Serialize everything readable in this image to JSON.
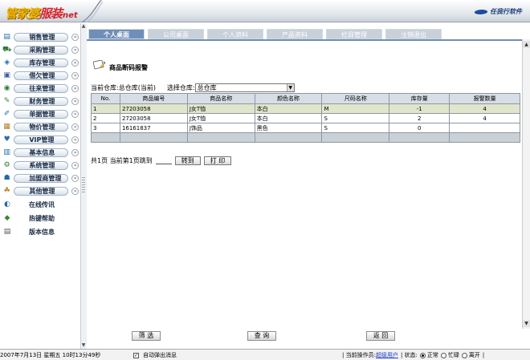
{
  "header": {
    "logo_part1": "管家婆",
    "logo_part2": "服装",
    "logo_part3": "net",
    "brand": "任我行软件"
  },
  "sidebar": {
    "items": [
      {
        "label": "销售管理",
        "icon": "sales-icon"
      },
      {
        "label": "采购管理",
        "icon": "purchase-icon"
      },
      {
        "label": "库存管理",
        "icon": "inventory-icon"
      },
      {
        "label": "借欠管理",
        "icon": "loan-icon"
      },
      {
        "label": "往来管理",
        "icon": "transaction-icon"
      },
      {
        "label": "财务管理",
        "icon": "finance-icon"
      },
      {
        "label": "单据管理",
        "icon": "voucher-icon"
      },
      {
        "label": "物价管理",
        "icon": "price-icon"
      },
      {
        "label": "VIP管理",
        "icon": "vip-icon"
      },
      {
        "label": "基本信息",
        "icon": "basic-info-icon"
      },
      {
        "label": "系统管理",
        "icon": "system-icon"
      },
      {
        "label": "加盟商管理",
        "icon": "franchise-icon"
      },
      {
        "label": "其他管理",
        "icon": "other-icon"
      },
      {
        "label": "在线传讯",
        "icon": "online-message-icon"
      },
      {
        "label": "热键帮助",
        "icon": "hotkey-help-icon"
      },
      {
        "label": "版本信息",
        "icon": "version-info-icon"
      }
    ]
  },
  "tabs": [
    {
      "label": "个人桌面",
      "active": true
    },
    {
      "label": "公司桌面",
      "active": false
    },
    {
      "label": "个人资料",
      "active": false
    },
    {
      "label": "产品资料",
      "active": false
    },
    {
      "label": "栏目管理",
      "active": false
    },
    {
      "label": "注销退出",
      "active": false
    }
  ],
  "main": {
    "page_title": "商品断码报警",
    "current_warehouse": "当前仓库:总仓库(当前)",
    "select_label": "选择仓库:",
    "select_value": "总仓库",
    "table": {
      "headers": [
        "No.",
        "商品编号",
        "商品名称",
        "颜色名称",
        "尺码名称",
        "库存量",
        "报警数量"
      ],
      "rows": [
        [
          "1",
          "27203058",
          "J女T恤",
          "本白",
          "M",
          "-1",
          "4"
        ],
        [
          "2",
          "27203058",
          "J女T恤",
          "本白",
          "S",
          "2",
          "4"
        ],
        [
          "3",
          "16161837",
          "J饰品",
          "黑色",
          "S",
          "0",
          ""
        ]
      ]
    },
    "pager": {
      "text": "共1页 当前第1页跳到",
      "jump_button": "转到",
      "print_button": "打 印"
    }
  },
  "bottom_buttons": {
    "filter": "筛 选",
    "query": "查 询",
    "back": "返 回"
  },
  "statusbar": {
    "datetime": "2007年7月13日 星期五 10时13分49秒",
    "auto_popup": "自动弹出消息",
    "operator_label": "| 当前操作员:",
    "operator": "超级用户",
    "status_label": "| 状态:",
    "status_options": [
      "正常",
      "忙碌",
      "离开"
    ],
    "status_selected": "正常",
    "trailing": "|"
  },
  "colors": {
    "tab_active": "#6f8fb8",
    "tab_inactive": "#c8d0d8",
    "selected_row": "#dfe6cc",
    "operator_link": "#1a3cc8"
  }
}
